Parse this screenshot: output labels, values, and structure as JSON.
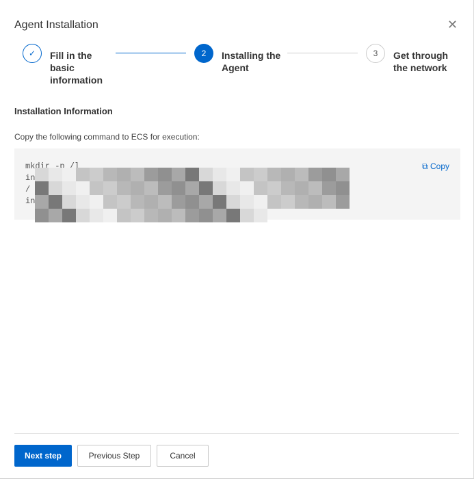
{
  "dialog": {
    "title": "Agent Installation",
    "close_icon": "close-icon"
  },
  "steps": [
    {
      "number": "✓",
      "label": "Fill in the basic information",
      "status": "completed"
    },
    {
      "number": "2",
      "label": "Installing the Agent",
      "status": "active"
    },
    {
      "number": "3",
      "label": "Get through the network",
      "status": "pending"
    }
  ],
  "main": {
    "section_title": "Installation Information",
    "hint": "Copy the following command to ECS for execution:",
    "command_lines": [
      "mkdir -p /l",
      "in",
      "/",
      "in"
    ],
    "copy_label": "Copy"
  },
  "footer": {
    "next": "Next step",
    "previous": "Previous Step",
    "cancel": "Cancel"
  },
  "colors": {
    "accent": "#0066cc"
  }
}
